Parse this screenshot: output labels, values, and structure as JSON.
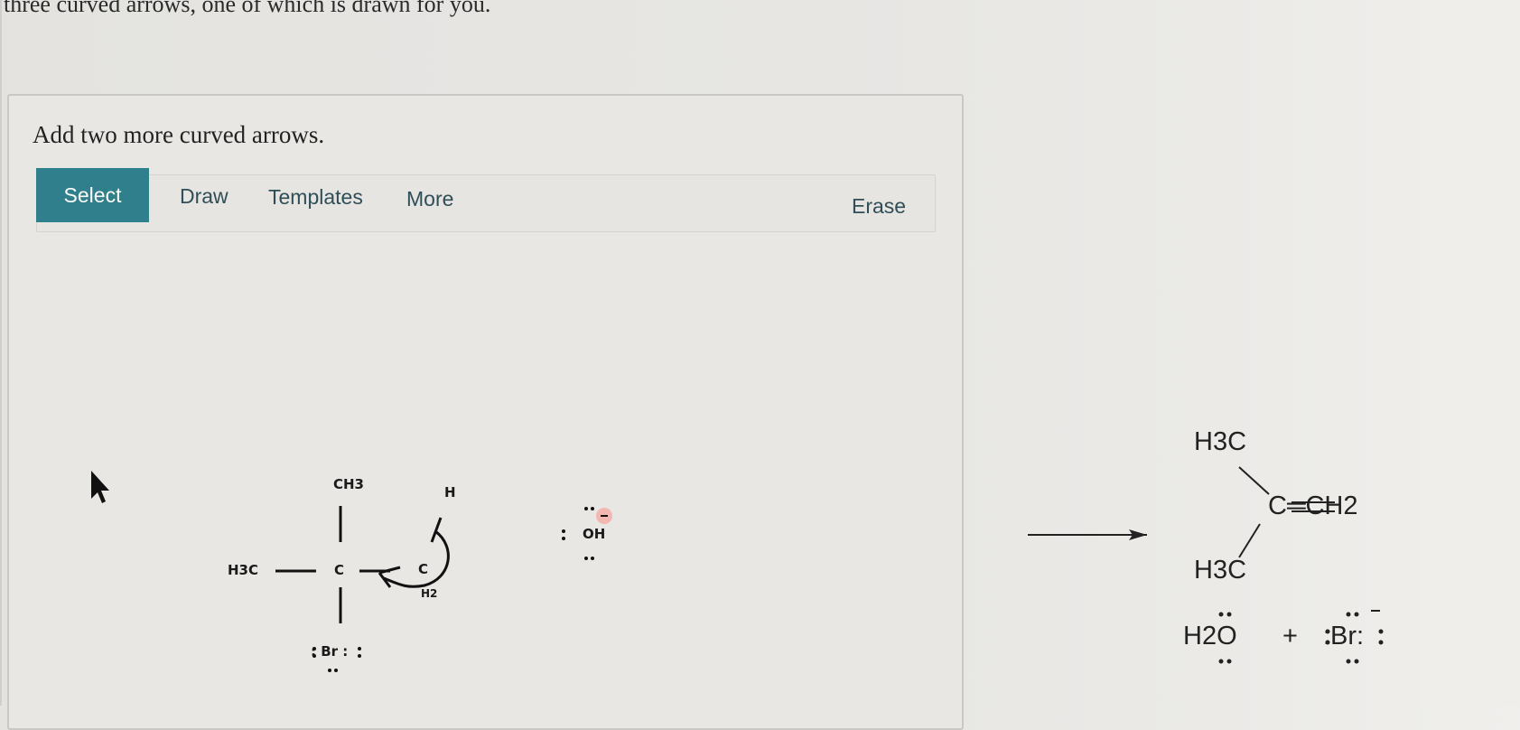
{
  "instruction_top": "three curved arrows, one of which is drawn for you.",
  "prompt": "Add two more curved arrows.",
  "toolbar": {
    "select": "Select",
    "draw": "Draw",
    "templates": "Templates",
    "more": "More",
    "erase": "Erase"
  },
  "reactant": {
    "ch3_top": "CH3",
    "h3c_left": "H3C",
    "c_center": "C",
    "c_right": "C",
    "h2": "H2",
    "h": "H",
    "br": ": Br :",
    "oh": "OH"
  },
  "products": {
    "h3c_top": "H3C",
    "alkene": "C═CH2",
    "h3c_bottom": "H3C",
    "water": "H2O",
    "plus": "+",
    "bromide": ":Br:"
  }
}
